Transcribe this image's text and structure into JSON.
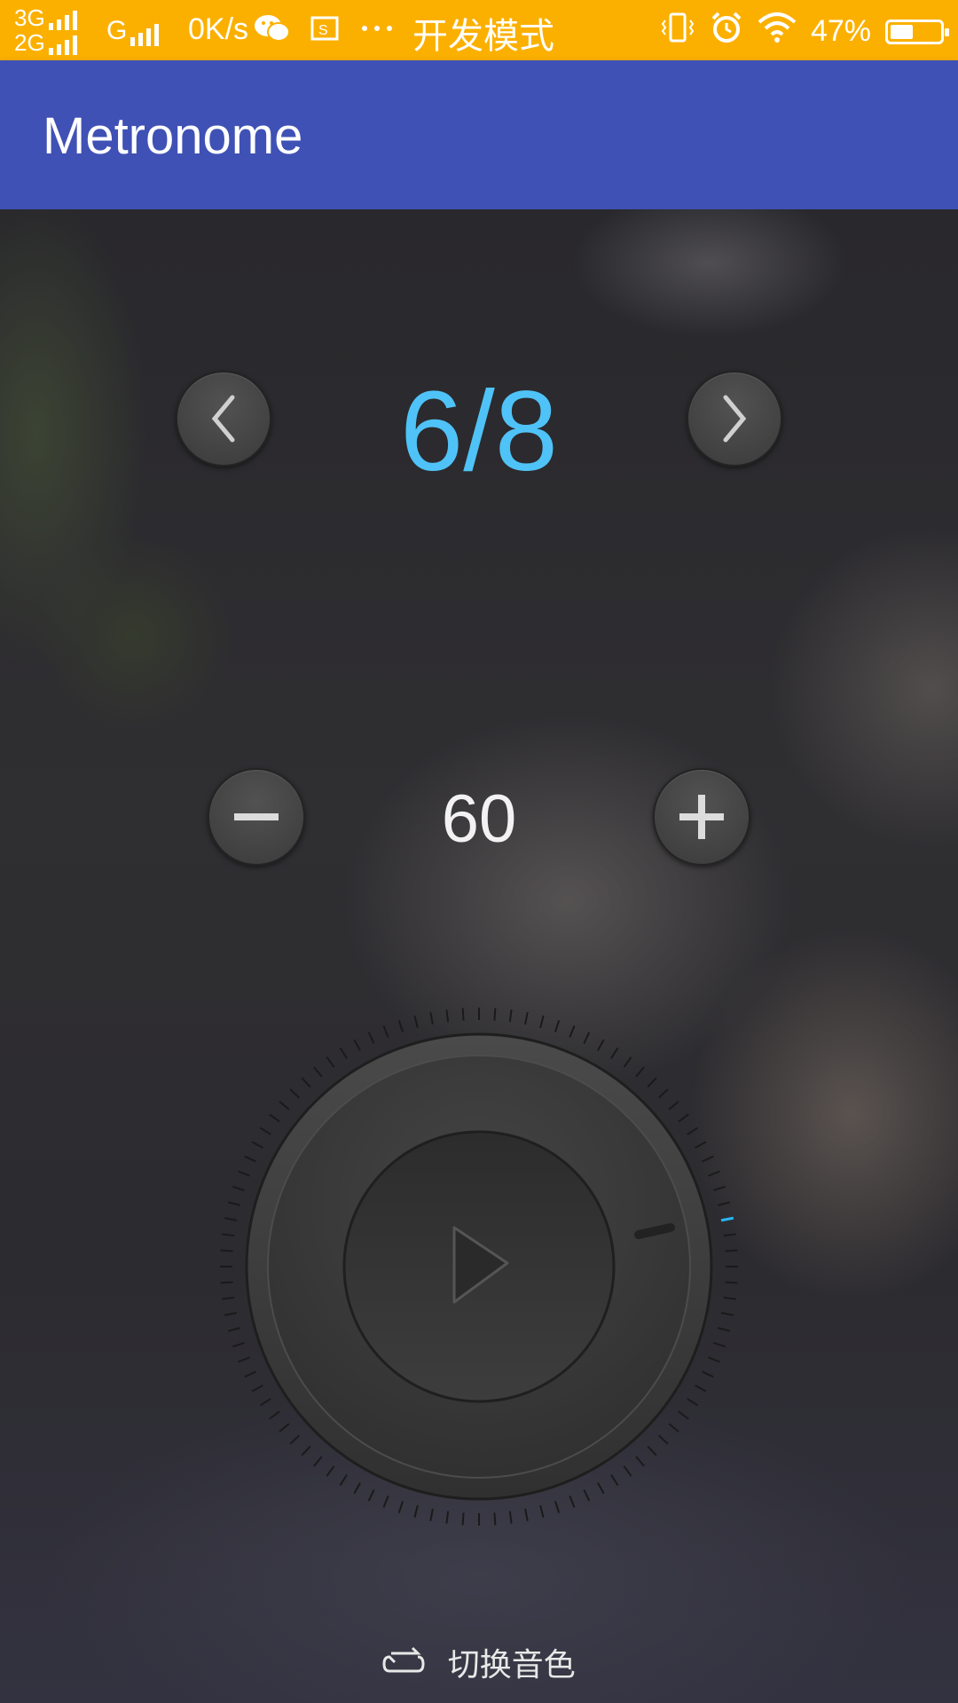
{
  "status_bar": {
    "network_top": "3G",
    "network_bottom": "2G",
    "network_g": "G",
    "speed": "0K/s",
    "mode": "开发模式",
    "battery": "47%",
    "battery_level": 0.47,
    "icons": [
      "wechat-icon",
      "screenshot-icon",
      "more-icon",
      "vibrate-icon",
      "alarm-icon",
      "wifi-icon",
      "battery-icon"
    ]
  },
  "app_bar": {
    "title": "Metronome"
  },
  "time_signature": {
    "value": "6/8",
    "color": "#4fc3f7"
  },
  "tempo": {
    "value": "60"
  },
  "dial": {
    "tick_count": 100,
    "accent": "#29b6f6"
  },
  "bottom": {
    "label": "切换音色"
  }
}
